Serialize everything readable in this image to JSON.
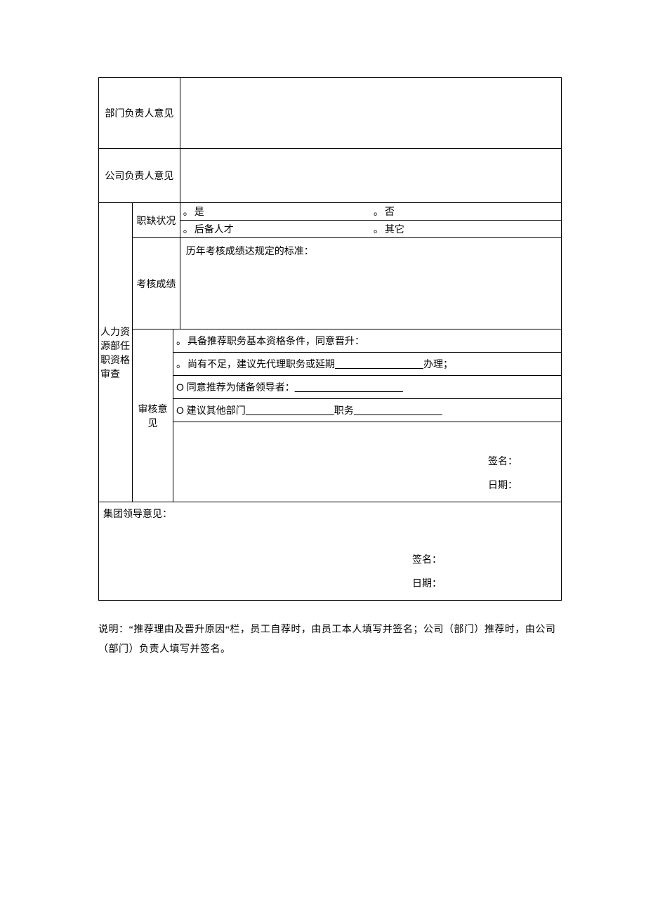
{
  "rows": {
    "dept_opinion_label": "部门负责人意见",
    "company_opinion_label": "公司负责人意见",
    "hr_section_label": "人力资源部任职资格审查",
    "vacancy_label": "职缺状况",
    "vacancy_yes": "是",
    "vacancy_no": "否",
    "vacancy_reserve": "后备人才",
    "vacancy_other": "其它",
    "assess_label": "考核成绩",
    "assess_heading": "历年考核成绩达规定的标准：",
    "review_label": "审核意见",
    "opt_qualified": "具备推荐职务基本资格条件，同意晋升：",
    "opt_gap_prefix": "尚有不足，建议先代理职务或延期",
    "opt_gap_suffix": "办理；",
    "opt_reserve_leader_prefix": "同意推荐为储备领导者：",
    "opt_other_dept_prefix": "建议其他部门",
    "opt_other_dept_mid": "职务",
    "signature_label": "签名：",
    "date_label": "日期：",
    "group_opinion_label": "集团领导意见：",
    "blank_short": "＿＿＿＿＿＿＿＿＿",
    "blank_mid": "＿＿＿＿＿＿＿＿＿＿＿"
  },
  "footer_note": "说明：“推荐理由及晋升原因“栏，员工自荐时，由员工本人填写并签名；公司（部门）推荐时，由公司（部门）负责人填写并签名。"
}
